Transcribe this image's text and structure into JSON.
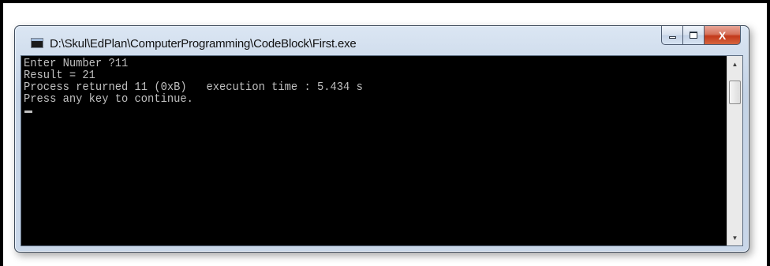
{
  "window": {
    "title": "D:\\Skul\\EdPlan\\ComputerProgramming\\CodeBlock\\First.exe",
    "minimize_icon": "minimize-icon",
    "maximize_icon": "maximize-icon",
    "close_glyph": "X"
  },
  "console": {
    "lines": [
      "Enter Number ?11",
      "Result = 21",
      "Process returned 11 (0xB)   execution time : 5.434 s",
      "Press any key to continue."
    ],
    "text_color": "#c0c0c0",
    "background": "#000000"
  },
  "scrollbar": {
    "up_glyph": "▲",
    "down_glyph": "▼"
  }
}
